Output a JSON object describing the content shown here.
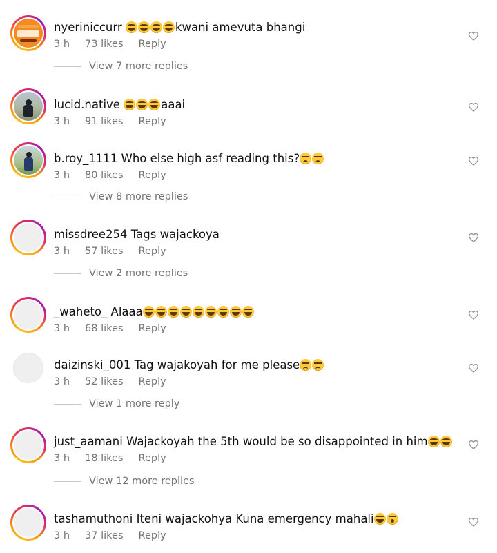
{
  "comments": [
    {
      "username": "nyeriniccurr",
      "text": "kwani amevuta bhangi",
      "emojis_before": 4,
      "emoji_kind": "laugh",
      "time": "3 h",
      "likes": "73 likes",
      "reply": "Reply",
      "avatar": "orange-logo",
      "view_replies": "View 7 more replies"
    },
    {
      "username": "lucid.native",
      "text": "aaai",
      "emojis_before": 3,
      "emoji_kind": "laugh",
      "time": "3 h",
      "likes": "91 likes",
      "reply": "Reply",
      "avatar": "photo",
      "view_replies": ""
    },
    {
      "username": "b.roy_1111",
      "text": "Who else high asf reading this?",
      "emojis_after": 2,
      "emoji_kind": "sad",
      "time": "3 h",
      "likes": "80 likes",
      "reply": "Reply",
      "avatar": "photo2",
      "view_replies": "View 8 more replies"
    },
    {
      "username": "missdree254",
      "text": "Tags wajackoya",
      "time": "3 h",
      "likes": "57 likes",
      "reply": "Reply",
      "avatar": "blank-story",
      "view_replies": "View 2 more replies"
    },
    {
      "username": "_waheto_",
      "text": "Alaaa",
      "emojis_after": 9,
      "emoji_kind": "laugh",
      "time": "3 h",
      "likes": "68 likes",
      "reply": "Reply",
      "avatar": "blank-story",
      "view_replies": ""
    },
    {
      "username": "daizinski_001",
      "text": "Tag wajakoyah for me please",
      "emojis_after": 2,
      "emoji_kind": "sad",
      "time": "3 h",
      "likes": "52 likes",
      "reply": "Reply",
      "avatar": "blank-plain",
      "view_replies": "View 1 more reply"
    },
    {
      "username": "just_aamani",
      "text": "Wajackoyah the 5th would be so disappointed in him",
      "emojis_after": 2,
      "emoji_kind": "laugh",
      "time": "3 h",
      "likes": "18 likes",
      "reply": "Reply",
      "avatar": "blank-story",
      "view_replies": "View 12 more replies"
    },
    {
      "username": "tashamuthoni",
      "text": "Iteni wajackohya Kuna emergency mahali",
      "emojis_after": 2,
      "emoji_kind": "laugh-wow",
      "time": "3 h",
      "likes": "37 likes",
      "reply": "Reply",
      "avatar": "blank-story",
      "view_replies": ""
    }
  ],
  "icons": {
    "like": "heart-outline-icon"
  },
  "colors": {
    "meta_text": "#737373",
    "story_ring": "#d62976",
    "text": "#111111"
  }
}
